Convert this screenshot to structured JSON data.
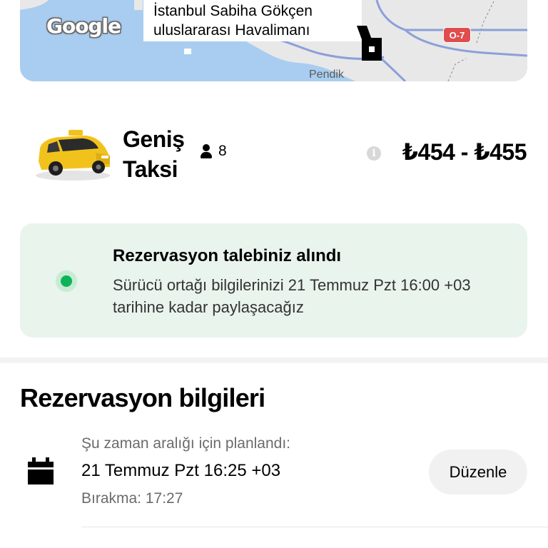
{
  "map": {
    "google_logo": "Google",
    "airport_label_line1": "İstanbul Sabiha Gökçen",
    "airport_label_line2": "uluslararası Havalimanı",
    "road_badge": "O-7",
    "place_label": "Pendik",
    "water_color": "#a9cdf0",
    "land_color": "#e8e8e8"
  },
  "ride": {
    "name_line1": "Geniş",
    "name_line2": "Taksi",
    "capacity": "8",
    "price_range": "₺454 - ₺455",
    "car_color": "#f2c21c"
  },
  "confirmation": {
    "title": "Rezervasyon talebiniz alındı",
    "body": "Sürücü ortağı bilgilerinizi 21 Temmuz Pzt 16:00 +03 tarihine kadar paylaşacağız",
    "accent": "#0cb35b"
  },
  "reservation": {
    "section_title": "Rezervasyon bilgileri",
    "scheduled_label": "Şu zaman aralığı için planlandı:",
    "scheduled_time": "21 Temmuz Pzt 16:25 +03",
    "dropoff": "Bırakma: 17:27",
    "edit_button": "Düzenle"
  }
}
